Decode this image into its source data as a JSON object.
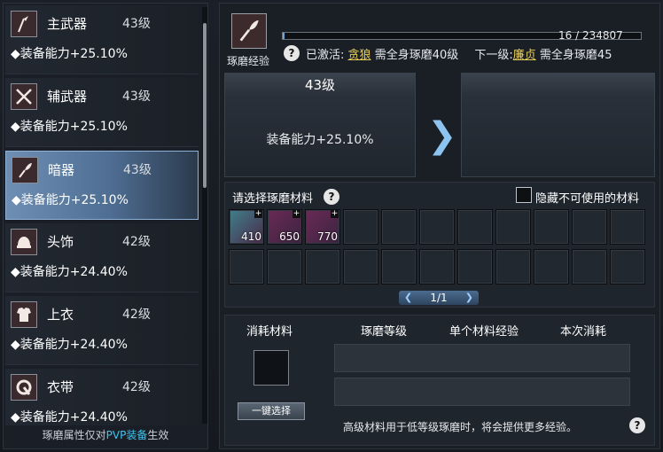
{
  "items": [
    {
      "name": "主武器",
      "level": "43级",
      "stat": "◆装备能力+25.10%",
      "icon": "spear-icon"
    },
    {
      "name": "辅武器",
      "level": "43级",
      "stat": "◆装备能力+25.10%",
      "icon": "crossed-swords-icon"
    },
    {
      "name": "暗器",
      "level": "43级",
      "stat": "◆装备能力+25.10%",
      "icon": "dagger-icon"
    },
    {
      "name": "头饰",
      "level": "42级",
      "stat": "◆装备能力+24.40%",
      "icon": "helmet-icon"
    },
    {
      "name": "上衣",
      "level": "42级",
      "stat": "◆装备能力+24.40%",
      "icon": "armor-icon"
    },
    {
      "name": "衣带",
      "level": "42级",
      "stat": "◆装备能力+24.40%",
      "icon": "belt-icon"
    }
  ],
  "footer": {
    "prefix": "琢磨属性仅对",
    "pvp": "PVP装备",
    "suffix": "生效"
  },
  "exp": {
    "label": "琢磨经验",
    "progress": "16 / 234807",
    "fraction": 0.0001
  },
  "activated": {
    "label": "已激活:",
    "name": "贪狼",
    "req": "需全身琢磨40级",
    "next_label": "下一级:",
    "next_name": "廉贞",
    "next_req": "需全身琢磨45"
  },
  "current": {
    "level": "43级",
    "stat": "装备能力+25.10%"
  },
  "materials": {
    "title": "请选择琢磨材料",
    "hide_label": "隐藏不可使用的材料",
    "slots": [
      "410",
      "650",
      "770"
    ],
    "page": "1/1"
  },
  "consume": {
    "col1": "消耗材料",
    "col2": "琢磨等级",
    "col3": "单个材料经验",
    "col4": "本次消耗",
    "button": "一键选择",
    "note": "高级材料用于低等级琢磨时，将会提供更多经验。"
  },
  "help": "?",
  "colors": {
    "accent": "#6fa6d8",
    "link": "#e9cf5a",
    "pvp": "#3ec6ee"
  }
}
